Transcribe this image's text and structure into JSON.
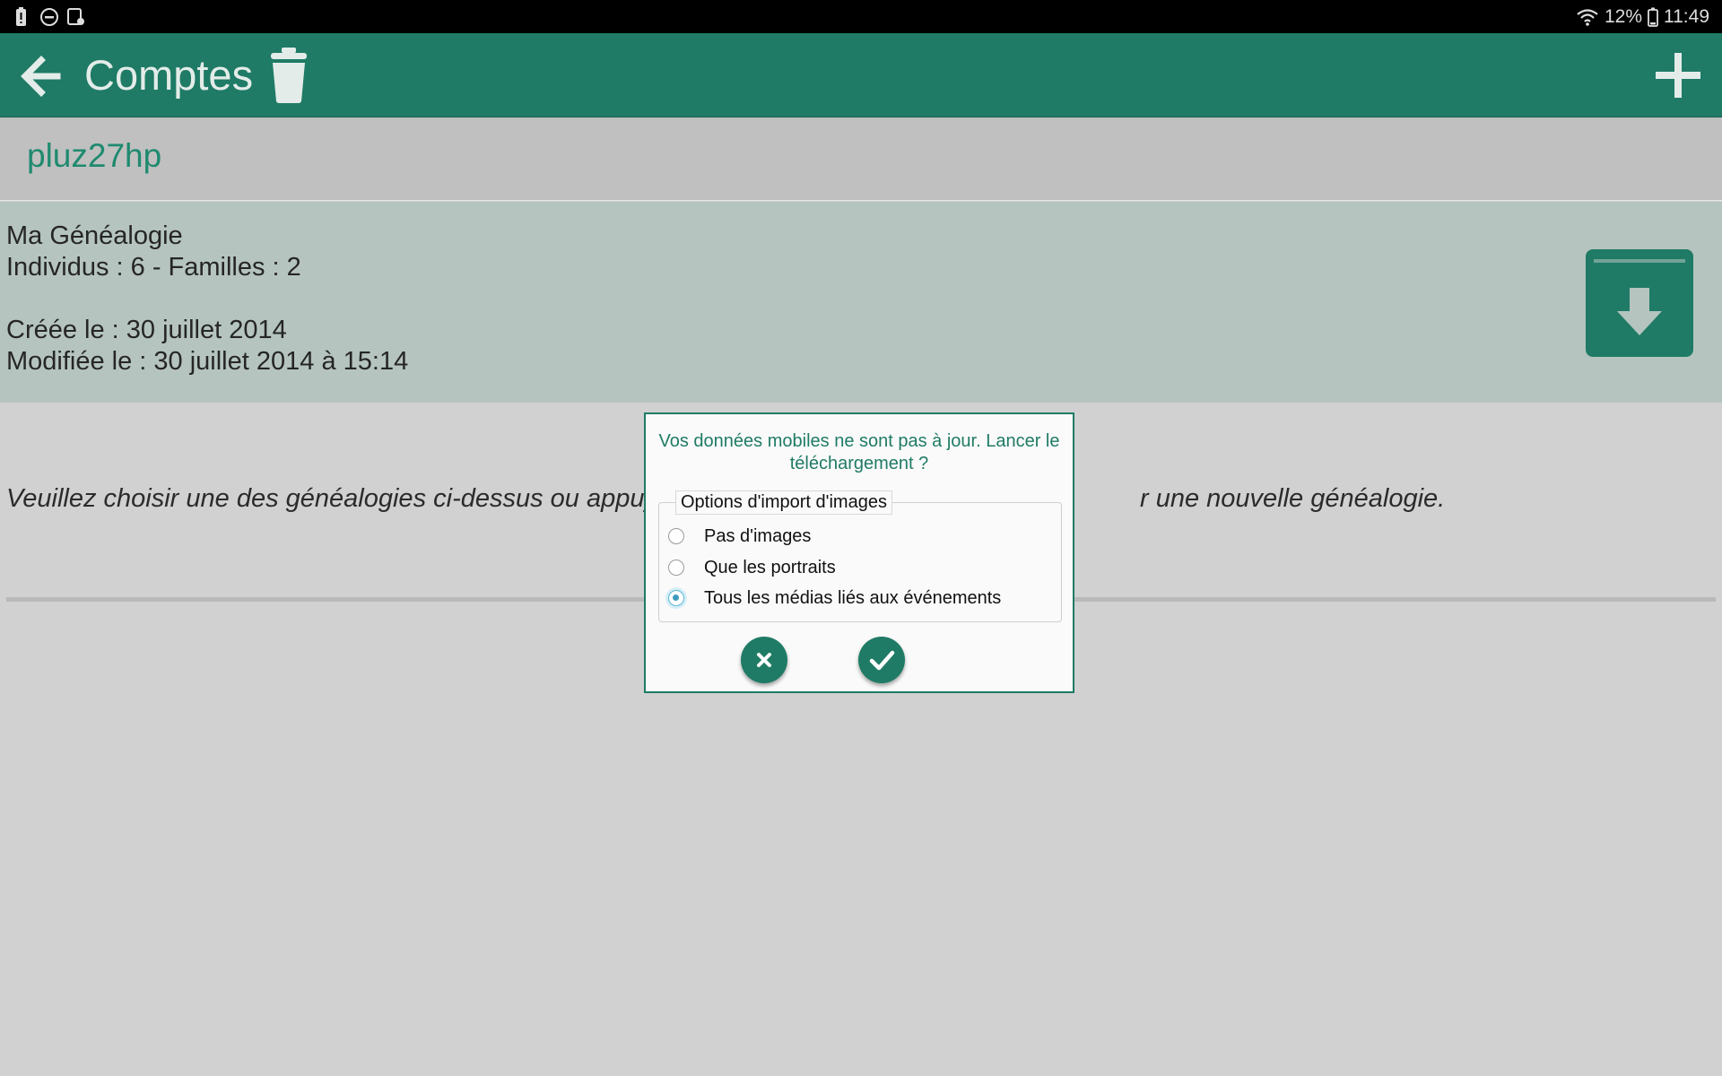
{
  "status_bar": {
    "battery_percent": "12%",
    "time": "11:49",
    "left_icons": [
      "battery-alert-icon",
      "do-not-disturb-icon",
      "screenshot-icon"
    ],
    "right_icons": [
      "wifi-icon",
      "battery-icon"
    ]
  },
  "action_bar": {
    "title": "Comptes",
    "icons": [
      "back-arrow-icon",
      "trash-icon",
      "plus-icon"
    ]
  },
  "account": {
    "name": "pluz27hp"
  },
  "genealogy": {
    "name": "Ma Généalogie",
    "counts": "Individus : 6 - Familles : 2",
    "created": "Créée le : 30 juillet 2014",
    "modified": "Modifiée le : 30 juillet 2014 à 15:14",
    "action_icon": "download-archive-icon"
  },
  "instruction": "Veuillez choisir une des généalogies ci-dessus ou appuy",
  "instruction_tail": "r une nouvelle généalogie.",
  "dialog": {
    "message": "Vos données mobiles ne sont pas à jour. Lancer le téléchargement ?",
    "group_label": "Options d'import d'images",
    "options": [
      {
        "label": "Pas d'images",
        "checked": false
      },
      {
        "label": "Que les portraits",
        "checked": false
      },
      {
        "label": "Tous les médias liés aux événements",
        "checked": true
      }
    ],
    "cancel_icon": "close-icon",
    "confirm_icon": "check-icon"
  },
  "colors": {
    "primary": "#1f7b65",
    "account_name": "#1f8a6f",
    "card_background": "#b5c4bf",
    "page_background": "#d1d1d1"
  }
}
